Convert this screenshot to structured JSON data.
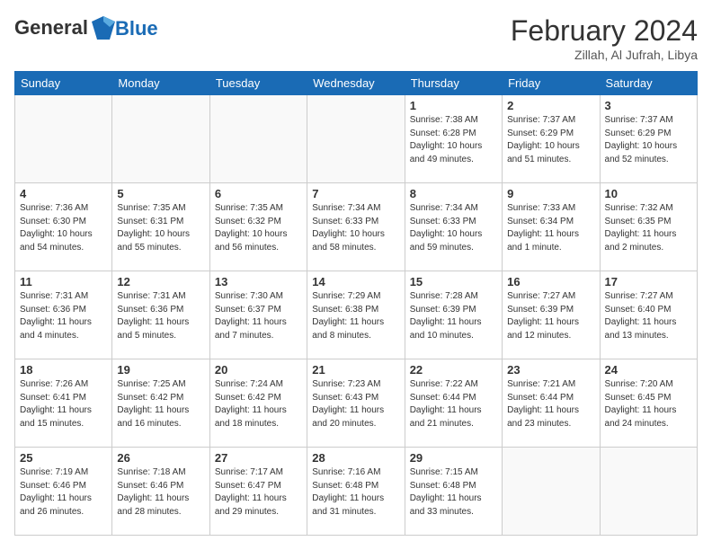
{
  "header": {
    "logo_line1": "General",
    "logo_line2": "Blue",
    "month_title": "February 2024",
    "location": "Zillah, Al Jufrah, Libya"
  },
  "weekdays": [
    "Sunday",
    "Monday",
    "Tuesday",
    "Wednesday",
    "Thursday",
    "Friday",
    "Saturday"
  ],
  "weeks": [
    [
      {
        "day": "",
        "info": ""
      },
      {
        "day": "",
        "info": ""
      },
      {
        "day": "",
        "info": ""
      },
      {
        "day": "",
        "info": ""
      },
      {
        "day": "1",
        "info": "Sunrise: 7:38 AM\nSunset: 6:28 PM\nDaylight: 10 hours\nand 49 minutes."
      },
      {
        "day": "2",
        "info": "Sunrise: 7:37 AM\nSunset: 6:29 PM\nDaylight: 10 hours\nand 51 minutes."
      },
      {
        "day": "3",
        "info": "Sunrise: 7:37 AM\nSunset: 6:29 PM\nDaylight: 10 hours\nand 52 minutes."
      }
    ],
    [
      {
        "day": "4",
        "info": "Sunrise: 7:36 AM\nSunset: 6:30 PM\nDaylight: 10 hours\nand 54 minutes."
      },
      {
        "day": "5",
        "info": "Sunrise: 7:35 AM\nSunset: 6:31 PM\nDaylight: 10 hours\nand 55 minutes."
      },
      {
        "day": "6",
        "info": "Sunrise: 7:35 AM\nSunset: 6:32 PM\nDaylight: 10 hours\nand 56 minutes."
      },
      {
        "day": "7",
        "info": "Sunrise: 7:34 AM\nSunset: 6:33 PM\nDaylight: 10 hours\nand 58 minutes."
      },
      {
        "day": "8",
        "info": "Sunrise: 7:34 AM\nSunset: 6:33 PM\nDaylight: 10 hours\nand 59 minutes."
      },
      {
        "day": "9",
        "info": "Sunrise: 7:33 AM\nSunset: 6:34 PM\nDaylight: 11 hours\nand 1 minute."
      },
      {
        "day": "10",
        "info": "Sunrise: 7:32 AM\nSunset: 6:35 PM\nDaylight: 11 hours\nand 2 minutes."
      }
    ],
    [
      {
        "day": "11",
        "info": "Sunrise: 7:31 AM\nSunset: 6:36 PM\nDaylight: 11 hours\nand 4 minutes."
      },
      {
        "day": "12",
        "info": "Sunrise: 7:31 AM\nSunset: 6:36 PM\nDaylight: 11 hours\nand 5 minutes."
      },
      {
        "day": "13",
        "info": "Sunrise: 7:30 AM\nSunset: 6:37 PM\nDaylight: 11 hours\nand 7 minutes."
      },
      {
        "day": "14",
        "info": "Sunrise: 7:29 AM\nSunset: 6:38 PM\nDaylight: 11 hours\nand 8 minutes."
      },
      {
        "day": "15",
        "info": "Sunrise: 7:28 AM\nSunset: 6:39 PM\nDaylight: 11 hours\nand 10 minutes."
      },
      {
        "day": "16",
        "info": "Sunrise: 7:27 AM\nSunset: 6:39 PM\nDaylight: 11 hours\nand 12 minutes."
      },
      {
        "day": "17",
        "info": "Sunrise: 7:27 AM\nSunset: 6:40 PM\nDaylight: 11 hours\nand 13 minutes."
      }
    ],
    [
      {
        "day": "18",
        "info": "Sunrise: 7:26 AM\nSunset: 6:41 PM\nDaylight: 11 hours\nand 15 minutes."
      },
      {
        "day": "19",
        "info": "Sunrise: 7:25 AM\nSunset: 6:42 PM\nDaylight: 11 hours\nand 16 minutes."
      },
      {
        "day": "20",
        "info": "Sunrise: 7:24 AM\nSunset: 6:42 PM\nDaylight: 11 hours\nand 18 minutes."
      },
      {
        "day": "21",
        "info": "Sunrise: 7:23 AM\nSunset: 6:43 PM\nDaylight: 11 hours\nand 20 minutes."
      },
      {
        "day": "22",
        "info": "Sunrise: 7:22 AM\nSunset: 6:44 PM\nDaylight: 11 hours\nand 21 minutes."
      },
      {
        "day": "23",
        "info": "Sunrise: 7:21 AM\nSunset: 6:44 PM\nDaylight: 11 hours\nand 23 minutes."
      },
      {
        "day": "24",
        "info": "Sunrise: 7:20 AM\nSunset: 6:45 PM\nDaylight: 11 hours\nand 24 minutes."
      }
    ],
    [
      {
        "day": "25",
        "info": "Sunrise: 7:19 AM\nSunset: 6:46 PM\nDaylight: 11 hours\nand 26 minutes."
      },
      {
        "day": "26",
        "info": "Sunrise: 7:18 AM\nSunset: 6:46 PM\nDaylight: 11 hours\nand 28 minutes."
      },
      {
        "day": "27",
        "info": "Sunrise: 7:17 AM\nSunset: 6:47 PM\nDaylight: 11 hours\nand 29 minutes."
      },
      {
        "day": "28",
        "info": "Sunrise: 7:16 AM\nSunset: 6:48 PM\nDaylight: 11 hours\nand 31 minutes."
      },
      {
        "day": "29",
        "info": "Sunrise: 7:15 AM\nSunset: 6:48 PM\nDaylight: 11 hours\nand 33 minutes."
      },
      {
        "day": "",
        "info": ""
      },
      {
        "day": "",
        "info": ""
      }
    ]
  ]
}
